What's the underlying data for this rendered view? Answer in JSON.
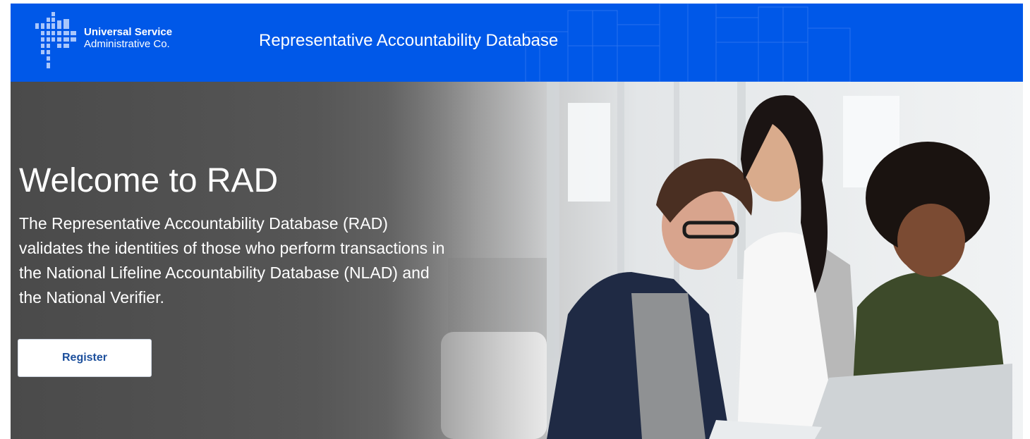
{
  "header": {
    "logo": {
      "line1": "Universal Service",
      "line2": "Administrative Co."
    },
    "app_title": "Representative Accountability Database",
    "background_color": "#0058e8"
  },
  "hero": {
    "title": "Welcome to RAD",
    "description": "The Representative Accountability Database (RAD) validates the identities of those who perform transactions in the National Lifeline Accountability Database (NLAD) and the National Verifier.",
    "register_label": "Register",
    "photo": "three-women-looking-at-laptop-photo"
  },
  "colors": {
    "header_blue": "#0058e8",
    "button_text": "#1c4f9c",
    "hero_text": "#ffffff"
  }
}
